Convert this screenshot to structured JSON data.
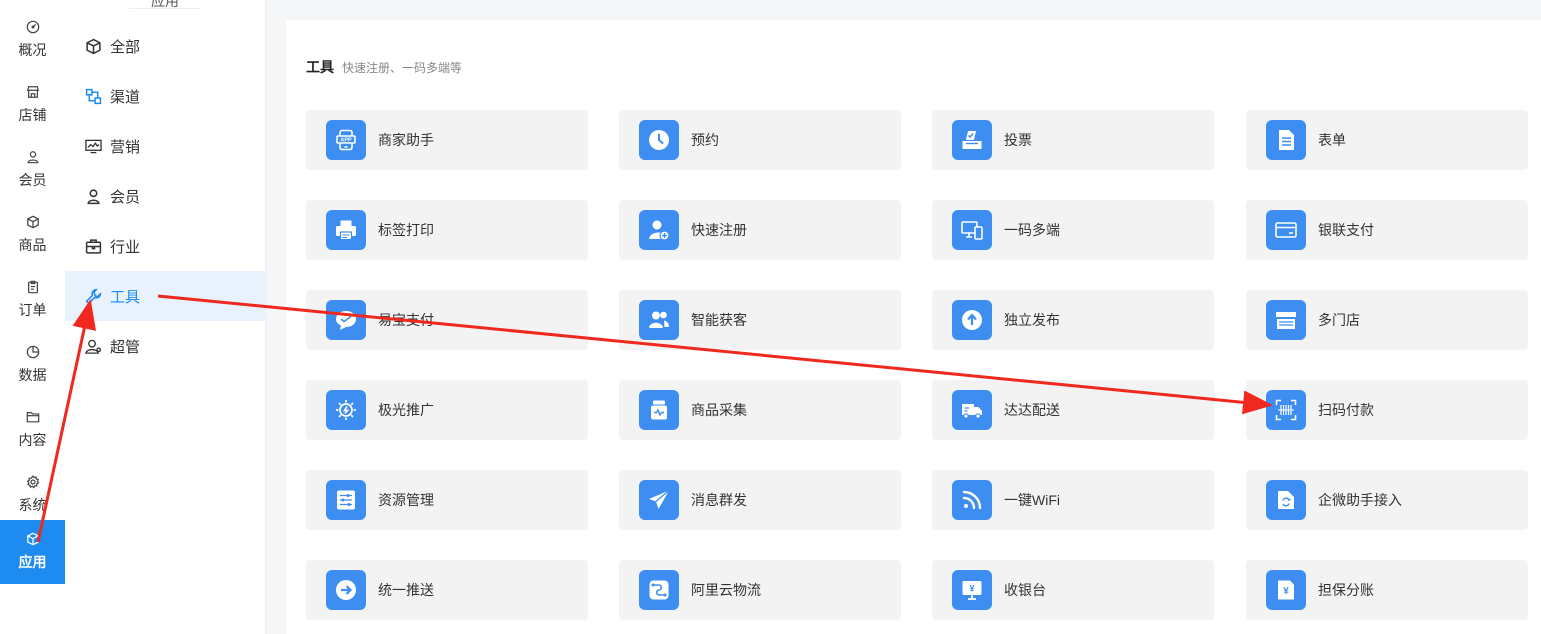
{
  "nav1": {
    "items": [
      {
        "label": "概况",
        "icon": "dashboard-icon"
      },
      {
        "label": "店铺",
        "icon": "store-icon"
      },
      {
        "label": "会员",
        "icon": "user-icon"
      },
      {
        "label": "商品",
        "icon": "box-icon"
      },
      {
        "label": "订单",
        "icon": "clipboard-icon"
      },
      {
        "label": "数据",
        "icon": "pie-chart-icon"
      },
      {
        "label": "内容",
        "icon": "folder-icon"
      },
      {
        "label": "系统",
        "icon": "gear-icon"
      },
      {
        "label": "应用",
        "icon": "cube-icon",
        "active": true
      }
    ]
  },
  "nav2": {
    "title": "应用",
    "items": [
      {
        "label": "全部",
        "icon": "cube-icon"
      },
      {
        "label": "渠道",
        "icon": "channel-icon"
      },
      {
        "label": "营销",
        "icon": "monitor-chart-icon"
      },
      {
        "label": "会员",
        "icon": "user-icon"
      },
      {
        "label": "行业",
        "icon": "briefcase-icon"
      },
      {
        "label": "工具",
        "icon": "wrench-icon",
        "active": true
      },
      {
        "label": "超管",
        "icon": "admin-user-icon"
      }
    ]
  },
  "section": {
    "title": "工具",
    "subtitle": "快速注册、一码多端等"
  },
  "cards": [
    {
      "label": "商家助手",
      "icon": "app-phone-icon"
    },
    {
      "label": "预约",
      "icon": "clock-icon"
    },
    {
      "label": "投票",
      "icon": "ballot-box-icon"
    },
    {
      "label": "表单",
      "icon": "document-icon"
    },
    {
      "label": "标签打印",
      "icon": "printer-icon"
    },
    {
      "label": "快速注册",
      "icon": "user-add-icon"
    },
    {
      "label": "一码多端",
      "icon": "multi-device-icon"
    },
    {
      "label": "银联支付",
      "icon": "bank-card-icon"
    },
    {
      "label": "易宝支付",
      "icon": "chat-bubble-icon"
    },
    {
      "label": "智能获客",
      "icon": "users-icon"
    },
    {
      "label": "独立发布",
      "icon": "upload-icon"
    },
    {
      "label": "多门店",
      "icon": "shop-awning-icon"
    },
    {
      "label": "极光推广",
      "icon": "aperture-icon"
    },
    {
      "label": "商品采集",
      "icon": "jar-icon"
    },
    {
      "label": "达达配送",
      "icon": "truck-icon"
    },
    {
      "label": "扫码付款",
      "icon": "barcode-scan-icon"
    },
    {
      "label": "资源管理",
      "icon": "sliders-icon"
    },
    {
      "label": "消息群发",
      "icon": "send-icon"
    },
    {
      "label": "一键WiFi",
      "icon": "wifi-icon"
    },
    {
      "label": "企微助手接入",
      "icon": "sync-folder-icon"
    },
    {
      "label": "统一推送",
      "icon": "arrow-circle-icon"
    },
    {
      "label": "阿里云物流",
      "icon": "logistics-icon"
    },
    {
      "label": "收银台",
      "icon": "cashier-icon"
    },
    {
      "label": "担保分账",
      "icon": "yen-document-icon"
    }
  ],
  "colors": {
    "accent": "#1e8bf0",
    "icon_tile": "#3d8ef0",
    "annotation_arrow": "#f0281e"
  }
}
